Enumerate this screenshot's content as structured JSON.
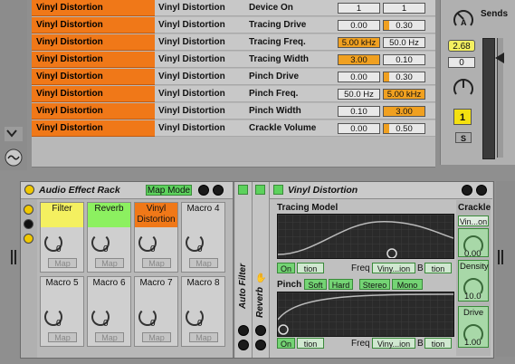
{
  "mapping_table": {
    "rows": [
      {
        "chain": "Vinyl Distortion",
        "device": "Vinyl Distortion",
        "param": "Device On",
        "min": "1",
        "max": "1",
        "hl": "none"
      },
      {
        "chain": "Vinyl Distortion",
        "device": "Vinyl Distortion",
        "param": "Tracing Drive",
        "min": "0.00",
        "max": "0.30",
        "hl": "none"
      },
      {
        "chain": "Vinyl Distortion",
        "device": "Vinyl Distortion",
        "param": "Tracing Freq.",
        "min": "5.00 kHz",
        "max": "50.0 Hz",
        "hl": "min"
      },
      {
        "chain": "Vinyl Distortion",
        "device": "Vinyl Distortion",
        "param": "Tracing Width",
        "min": "3.00",
        "max": "0.10",
        "hl": "min"
      },
      {
        "chain": "Vinyl Distortion",
        "device": "Vinyl Distortion",
        "param": "Pinch Drive",
        "min": "0.00",
        "max": "0.30",
        "hl": "none"
      },
      {
        "chain": "Vinyl Distortion",
        "device": "Vinyl Distortion",
        "param": "Pinch Freq.",
        "min": "50.0 Hz",
        "max": "5.00 kHz",
        "hl": "max"
      },
      {
        "chain": "Vinyl Distortion",
        "device": "Vinyl Distortion",
        "param": "Pinch Width",
        "min": "0.10",
        "max": "3.00",
        "hl": "max"
      },
      {
        "chain": "Vinyl Distortion",
        "device": "Vinyl Distortion",
        "param": "Crackle Volume",
        "min": "0.00",
        "max": "0.50",
        "hl": "none"
      }
    ]
  },
  "sends": {
    "label": "Sends",
    "send_a_letter": "A",
    "value_yellow": "2.68",
    "value_box": "0",
    "track_number": "1",
    "solo_label": "S"
  },
  "rack": {
    "title": "Audio Effect Rack",
    "map_mode_label": "Map Mode",
    "map_label": "Map",
    "macros": [
      {
        "name": "Filter",
        "value": "0",
        "color": "#f4f060"
      },
      {
        "name": "Reverb",
        "value": "0",
        "color": "#8cf060"
      },
      {
        "name": "Vinyl Distortion",
        "value": "0",
        "color": "#f07818"
      },
      {
        "name": "Macro 4",
        "value": "0",
        "color": "#cfcfcf"
      },
      {
        "name": "Macro 5",
        "value": "0",
        "color": "#cfcfcf"
      },
      {
        "name": "Macro 6",
        "value": "0",
        "color": "#cfcfcf"
      },
      {
        "name": "Macro 7",
        "value": "0",
        "color": "#cfcfcf"
      },
      {
        "name": "Macro 8",
        "value": "0",
        "color": "#cfcfcf"
      }
    ]
  },
  "chain_devices": {
    "auto_filter": "Auto Filter",
    "reverb": "Reverb"
  },
  "vinyl": {
    "title": "Vinyl Distortion",
    "tracing_model": "Tracing Model",
    "on": "On",
    "tion": "tion",
    "freq": "Freq",
    "viny_ion": "Viny...ion",
    "b": "B",
    "pinch": "Pinch",
    "soft": "Soft",
    "hard": "Hard",
    "stereo": "Stereo",
    "mono": "Mono",
    "crackle": "Crackle",
    "vin_on": "Vin...on",
    "crackle_value": "0.00",
    "density_label": "Density",
    "density_value": "10.0",
    "drive_label": "Drive",
    "drive_value": "1.00"
  },
  "colors": {
    "orange": "#f07818",
    "green": "#5dd25d",
    "yellow": "#f4f060"
  }
}
